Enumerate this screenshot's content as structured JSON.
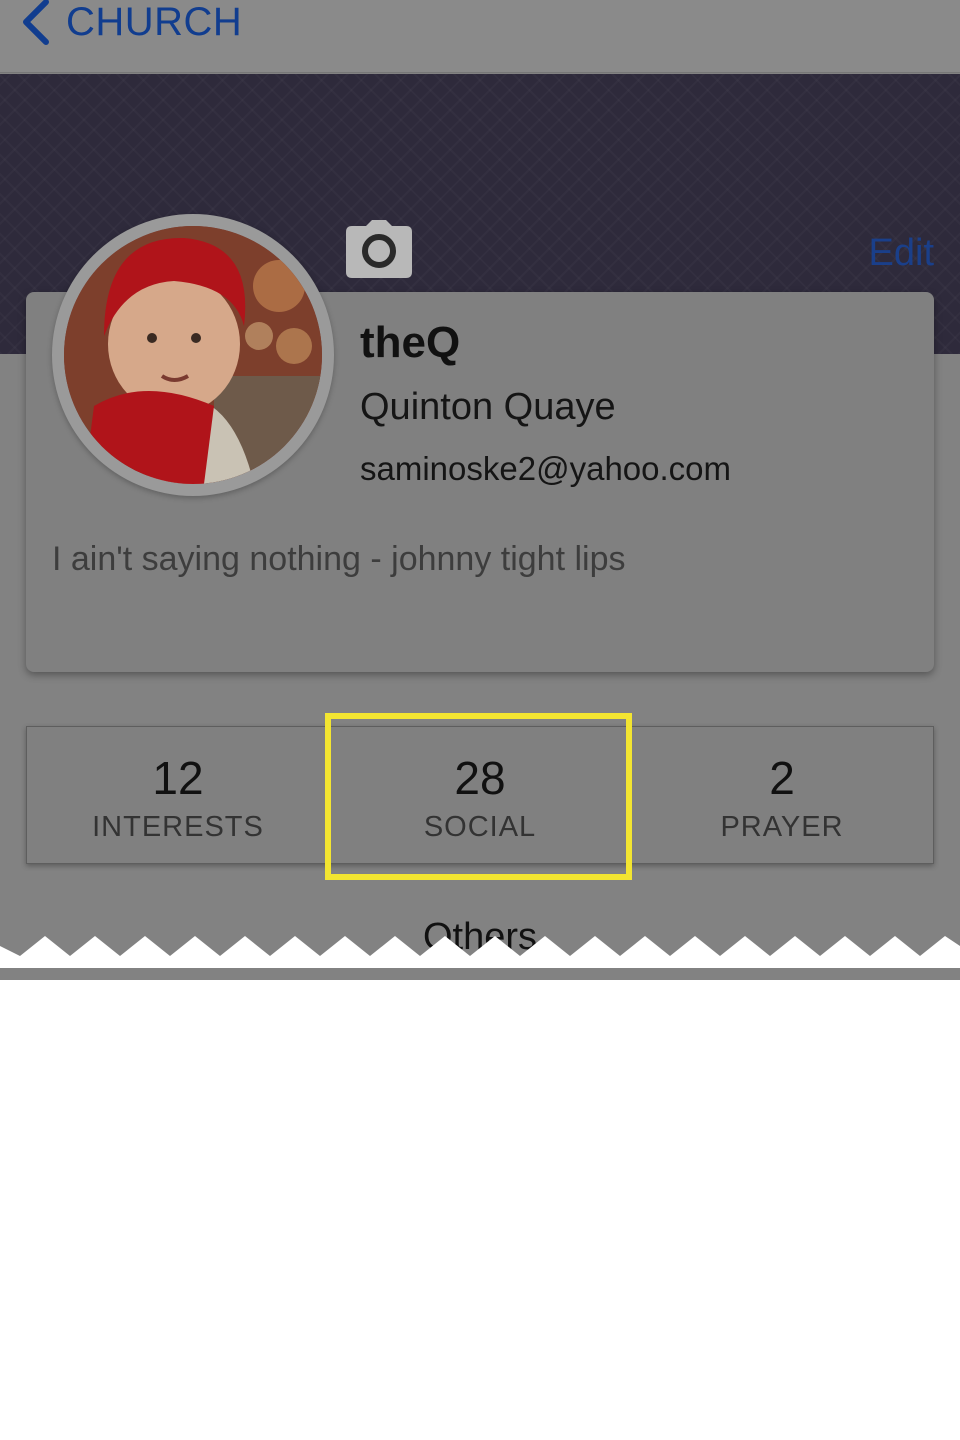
{
  "navbar": {
    "back_label": "CHURCH"
  },
  "header": {
    "edit_label": "Edit"
  },
  "profile": {
    "username": "theQ",
    "full_name": "Quinton Quaye",
    "email": "saminoske2@yahoo.com",
    "bio": "I ain't saying nothing - johnny tight lips"
  },
  "stats": [
    {
      "value": "12",
      "label": "INTERESTS"
    },
    {
      "value": "28",
      "label": "SOCIAL"
    },
    {
      "value": "2",
      "label": "PRAYER"
    }
  ],
  "section": {
    "others_label": "Others"
  },
  "colors": {
    "accent": "#113d8f",
    "highlight": "#f3e531",
    "header": "#2e2a3b"
  },
  "icons": [
    "chevron-left-icon",
    "camera-icon"
  ]
}
